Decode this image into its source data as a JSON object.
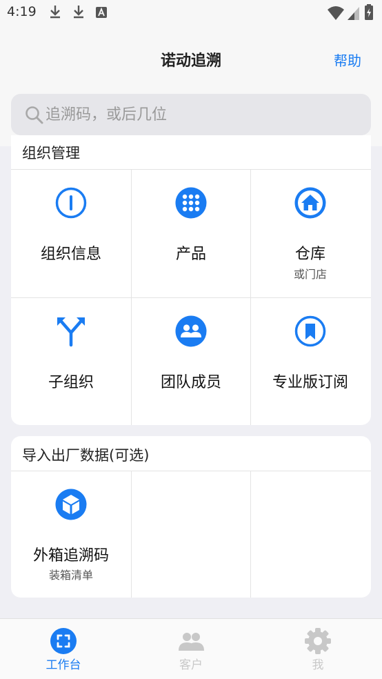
{
  "status_bar": {
    "time": "4:19"
  },
  "header": {
    "title": "诺动追溯",
    "help_label": "帮助"
  },
  "search": {
    "placeholder": "追溯码，或后几位"
  },
  "section_org": {
    "title": "组织管理",
    "items": [
      {
        "label": "组织信息",
        "icon": "info-icon"
      },
      {
        "label": "产品",
        "icon": "grid-icon"
      },
      {
        "label": "仓库",
        "sub": "或门店",
        "icon": "home-icon"
      },
      {
        "label": "子组织",
        "icon": "fork-icon"
      },
      {
        "label": "团队成员",
        "icon": "team-icon"
      },
      {
        "label": "专业版订阅",
        "icon": "bookmark-icon"
      }
    ]
  },
  "section_import": {
    "title": "导入出厂数据(可选)",
    "items": [
      {
        "label": "外箱追溯码",
        "sub": "装箱清单",
        "icon": "box-icon"
      }
    ]
  },
  "tabs": [
    {
      "label": "工作台",
      "icon": "scan-icon",
      "active": true
    },
    {
      "label": "客户",
      "icon": "users-icon",
      "active": false
    },
    {
      "label": "我",
      "icon": "gear-icon",
      "active": false
    }
  ],
  "colors": {
    "accent": "#1a7cf2",
    "inactive": "#c8c8c8"
  }
}
